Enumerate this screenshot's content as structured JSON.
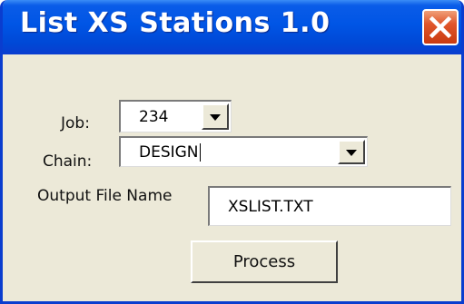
{
  "window": {
    "title": "List XS Stations 1.0",
    "close_icon": "close-icon",
    "accent_color": "#0055e5",
    "close_color": "#e0562b"
  },
  "form": {
    "job": {
      "label": "Job:",
      "value": "234",
      "dropdown_icon": "chevron-down-icon"
    },
    "chain": {
      "label": "Chain:",
      "value": "DESIGN",
      "dropdown_icon": "chevron-down-icon"
    },
    "output_file": {
      "label": "Output File Name",
      "value": "XSLIST.TXT"
    }
  },
  "actions": {
    "process_label": "Process"
  }
}
